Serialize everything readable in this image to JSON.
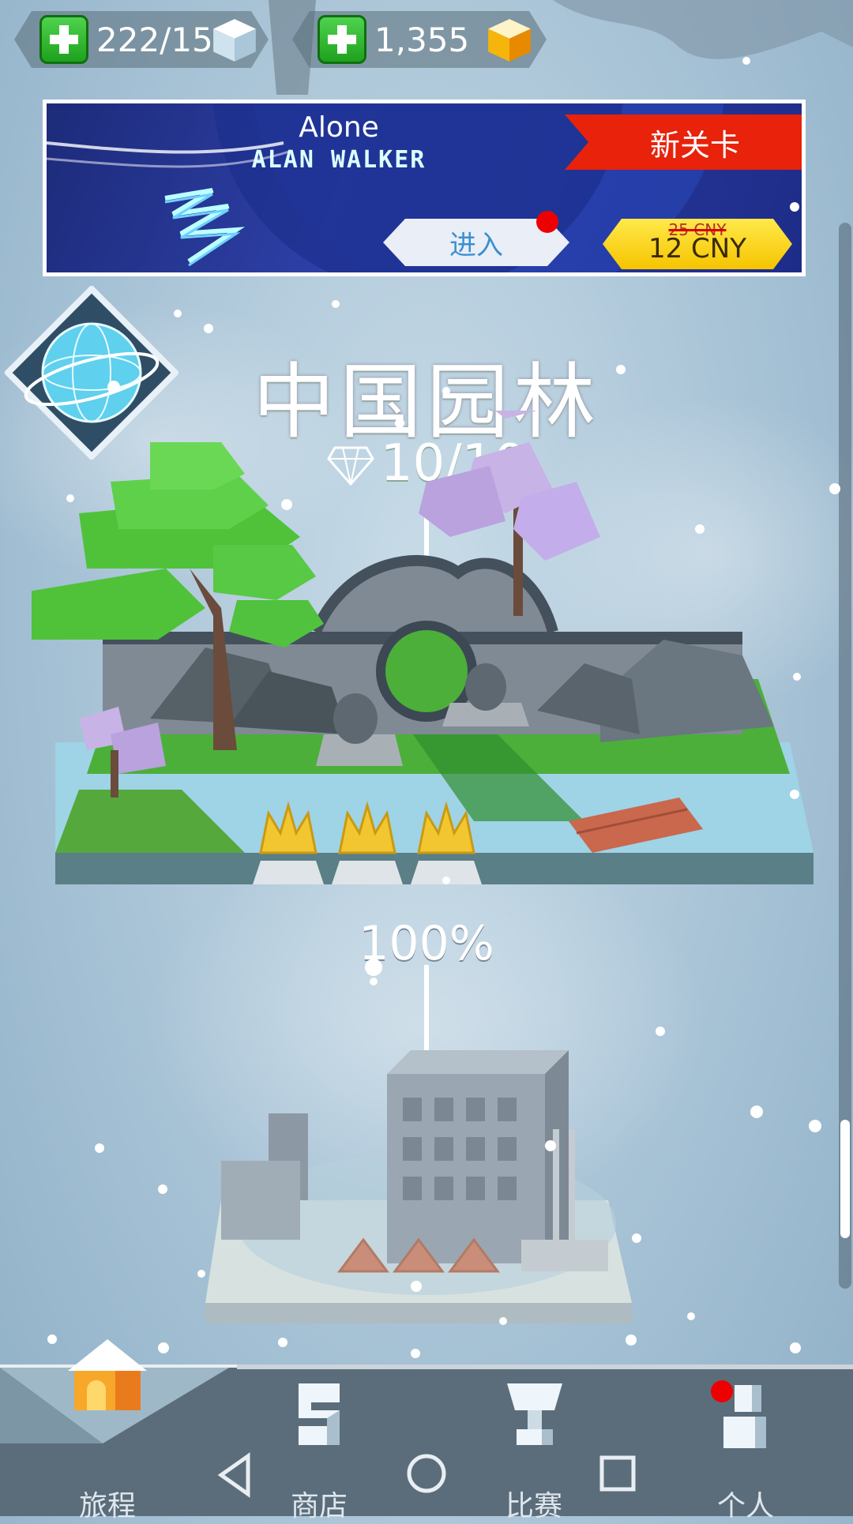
{
  "currency": {
    "cubes": "222/15",
    "gems": "1,355"
  },
  "banner": {
    "song_title": "Alone",
    "artist": "ALAN WALKER",
    "enter_label": "进入",
    "new_level_label": "新关卡",
    "old_price": "25 CNY",
    "new_price": "12 CNY"
  },
  "level": {
    "title": "中国园林",
    "gems_progress": "10/10",
    "completion": "100%",
    "crowns_earned": 3,
    "crowns_total": 3
  },
  "next_level": {
    "crowns_earned": 0,
    "crowns_total": 3
  },
  "nav": {
    "items": [
      {
        "label": "旅程",
        "icon": "house-icon",
        "active": true
      },
      {
        "label": "商店",
        "icon": "shop-icon",
        "active": false
      },
      {
        "label": "比赛",
        "icon": "trophy-icon",
        "active": false
      },
      {
        "label": "个人",
        "icon": "profile-icon",
        "active": false,
        "notification": true
      }
    ]
  },
  "colors": {
    "accent_green": "#2ebc2e",
    "banner_red": "#e8220b",
    "price_yellow": "#f6c400",
    "background": "#a8c3d6"
  }
}
